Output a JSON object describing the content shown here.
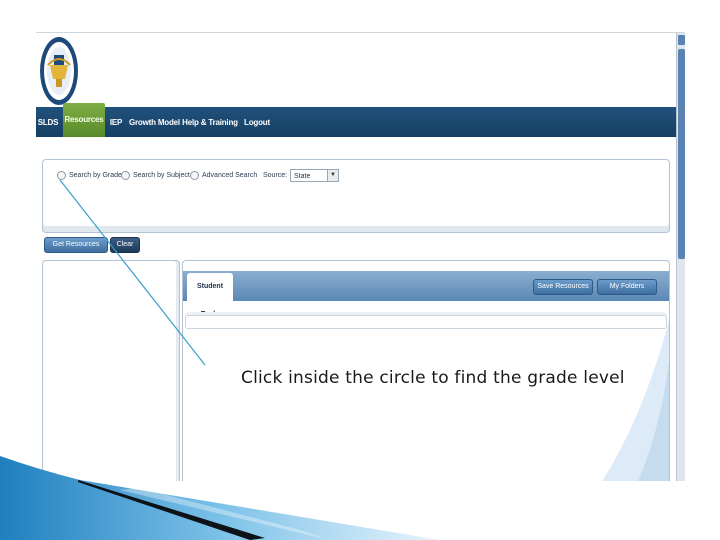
{
  "nav": {
    "items": [
      {
        "label": "SLDS"
      },
      {
        "label": "Resources",
        "active": true
      },
      {
        "label": "IEP"
      },
      {
        "label": "Growth Model"
      },
      {
        "label": "Help & Training"
      },
      {
        "label": "Logout"
      }
    ]
  },
  "search": {
    "options": [
      {
        "label": "Search by Grade"
      },
      {
        "label": "Search by Subject"
      },
      {
        "label": "Advanced Search"
      }
    ],
    "source_label": "Source:",
    "source_value": "State",
    "get_resources_label": "Get Resources",
    "clear_label": "Clear"
  },
  "tools": {
    "tab_label": "Student Tools",
    "save_resources_label": "Save Resources",
    "my_folders_label": "My Folders"
  },
  "callout": {
    "text": "Click inside the circle to find the grade level"
  },
  "colors": {
    "nav_bg": "#1b4a73",
    "nav_active": "#6c9c3a",
    "button_light": "#4a7fb3",
    "button_dark": "#2a4a6c",
    "callout_line": "#3a9fc8"
  },
  "icons": {
    "logo": "county-seal-logo",
    "dropdown": "chevron-down-icon",
    "radio": "radio-button"
  }
}
